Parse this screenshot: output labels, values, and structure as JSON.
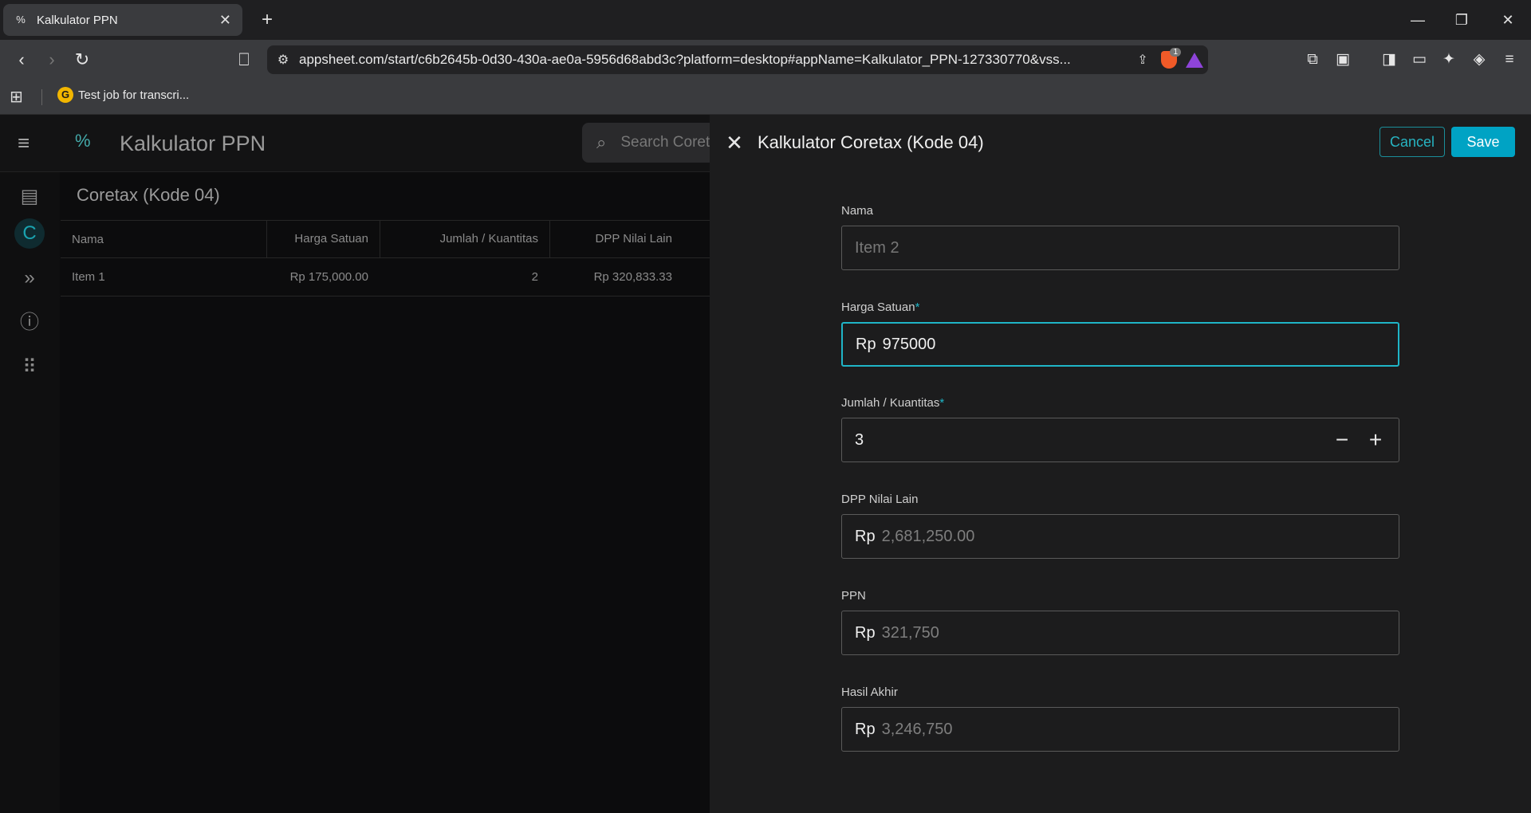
{
  "browser": {
    "tab_title": "Kalkulator PPN",
    "tab_favicon": "%",
    "url": "appsheet.com/start/c6b2645b-0d30-430a-ae0a-5956d68abd3c?platform=desktop#appName=Kalkulator_PPN-127330770&vss...",
    "shield_count": "1",
    "bookmark_label": "Test job for transcri..."
  },
  "app": {
    "title": "Kalkulator PPN",
    "search_placeholder": "Search Coretax",
    "view_title": "Coretax (Kode 04)",
    "table": {
      "headers": [
        "Nama",
        "Harga Satuan",
        "Jumlah / Kuantitas",
        "DPP Nilai Lain"
      ],
      "rows": [
        [
          "Item 1",
          "Rp 175,000.00",
          "2",
          "Rp 320,833.33"
        ]
      ]
    }
  },
  "form": {
    "title": "Kalkulator Coretax (Kode 04)",
    "cancel_label": "Cancel",
    "save_label": "Save",
    "currency_prefix": "Rp",
    "required_mark": "*",
    "nama": {
      "label": "Nama",
      "placeholder": "Item 2"
    },
    "harga": {
      "label": "Harga Satuan",
      "value": "975000"
    },
    "jumlah": {
      "label": "Jumlah / Kuantitas",
      "value": "3",
      "minus": "−",
      "plus": "+"
    },
    "dpp": {
      "label": "DPP Nilai Lain",
      "value": "2,681,250.00"
    },
    "ppn": {
      "label": "PPN",
      "value": "321,750"
    },
    "hasil": {
      "label": "Hasil Akhir",
      "value": "3,246,750"
    }
  },
  "colors": {
    "accent": "#1fb5c7",
    "save_bg": "#00a3c4"
  }
}
